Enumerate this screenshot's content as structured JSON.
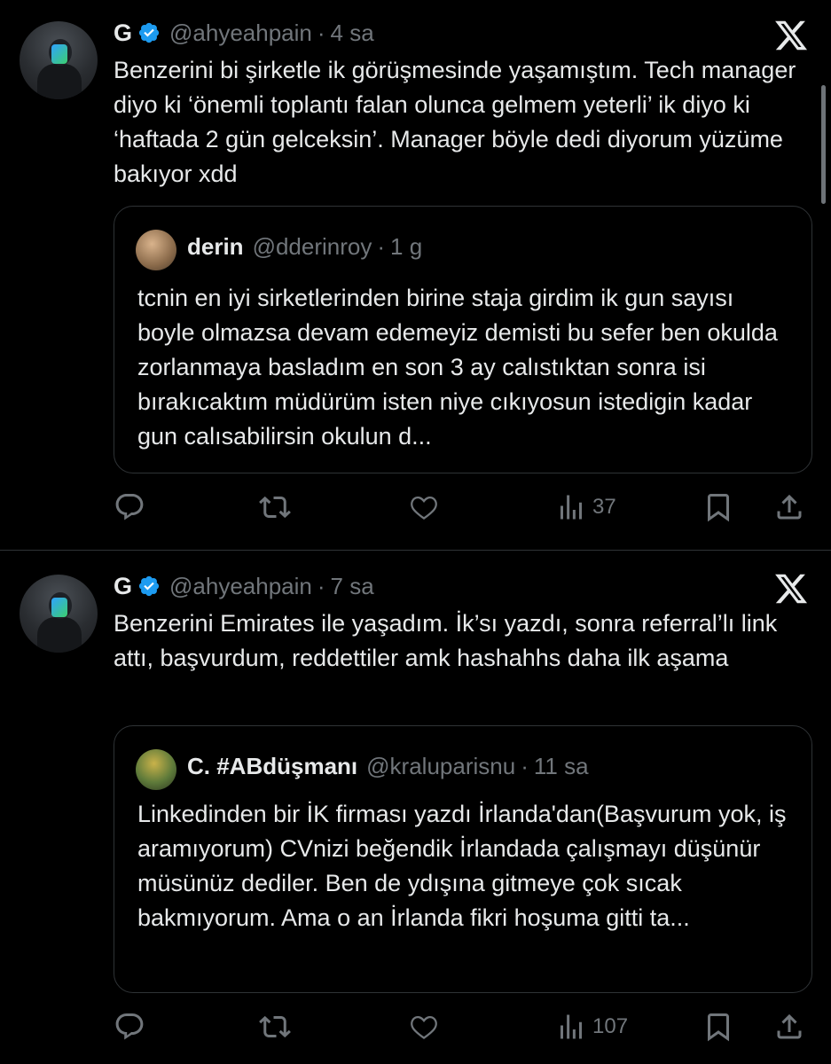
{
  "tweets": [
    {
      "author_name": "G",
      "handle": "@ahyeahpain",
      "separator": "·",
      "time": "4 sa",
      "text": "Benzerini bi şirketle ik görüşmesinde yaşamıştım. Tech manager diyo ki ‘önemli toplantı falan olunca gelmem yeterli’ ik diyo ki ‘haftada 2 gün gelceksin’. Manager böyle dedi diyorum yüzüme bakıyor xdd",
      "quote": {
        "author_name": "derin",
        "handle": "@dderinroy",
        "separator": "·",
        "time": "1 g",
        "text": "tcnin en iyi sirketlerinden birine staja girdim ik gun sayısı boyle olmazsa devam edemeyiz demisti bu sefer ben okulda zorlanmaya basladım en son 3 ay calıstıktan sonra isi bırakıcaktım müdürüm isten niye cıkıyosun istedigin kadar gun calısabilirsin okulun d..."
      },
      "views": "37"
    },
    {
      "author_name": "G",
      "handle": "@ahyeahpain",
      "separator": "·",
      "time": "7 sa",
      "text": "Benzerini Emirates ile yaşadım. İk’sı yazdı, sonra referral’lı link attı, başvurdum, reddettiler amk hashahhs daha ilk aşama",
      "quote": {
        "author_name": "C. #ABdüşmanı",
        "handle": "@kraluparisnu",
        "separator": "·",
        "time": "11 sa",
        "text": "Linkedinden bir İK firması yazdı İrlanda'dan(Başvurum yok, iş aramıyorum) CVnizi beğendik İrlandada çalışmayı düşünür müsünüz dediler. Ben de ydışına gitmeye çok sıcak bakmıyorum. Ama o an İrlanda fikri hoşuma gitti ta..."
      },
      "views": "107"
    }
  ],
  "colors": {
    "background": "#000000",
    "text_primary": "#e7e9ea",
    "text_secondary": "#71767b",
    "border": "#2f3336",
    "verified_blue": "#1d9bf0"
  },
  "icons": [
    "verified-badge-icon",
    "x-logo-icon",
    "reply-icon",
    "repost-icon",
    "like-icon",
    "views-icon",
    "bookmark-icon",
    "share-icon"
  ]
}
